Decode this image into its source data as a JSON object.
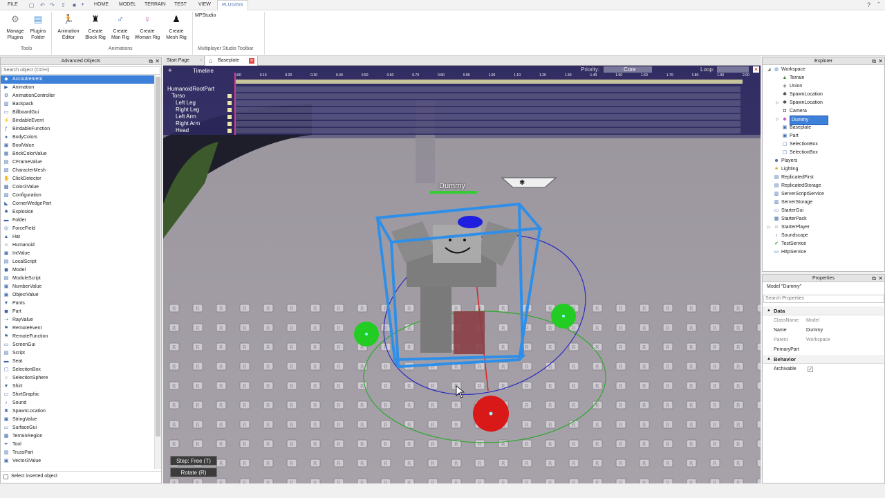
{
  "menubar": {
    "tabs": [
      "FILE",
      "HOME",
      "MODEL",
      "TERRAIN",
      "TEST",
      "VIEW",
      "PLUGINS"
    ]
  },
  "ribbon": {
    "buttons": {
      "manage_plugins": "Manage Plugins",
      "plugins_folder": "Plugins Folder",
      "animation_editor": "Animation Editor",
      "create_block_rig": "Create Block Rig",
      "create_man_rig": "Create Man Rig",
      "create_woman_rig": "Create Woman Rig",
      "create_mesh_rig": "Create Mesh Rig",
      "mpstudio": "MPStudio"
    },
    "groups": {
      "tools": "Tools",
      "animations": "Animations",
      "mp_toolbar": "Multiplayer Studio Toolbar"
    }
  },
  "advanced_objects": {
    "title": "Advanced Objects",
    "search_placeholder": "Search object (Ctrl+I)",
    "items": [
      "Accoutrement",
      "Animation",
      "AnimationController",
      "Backpack",
      "BillboardGui",
      "BindableEvent",
      "BindableFunction",
      "BodyColors",
      "BoolValue",
      "BrickColorValue",
      "CFrameValue",
      "CharacterMesh",
      "ClickDetector",
      "Color3Value",
      "Configuration",
      "CornerWedgePart",
      "Explosion",
      "Folder",
      "ForceField",
      "Hat",
      "Humanoid",
      "IntValue",
      "LocalScript",
      "Model",
      "ModuleScript",
      "NumberValue",
      "ObjectValue",
      "Pants",
      "Part",
      "RayValue",
      "RemoteEvent",
      "RemoteFunction",
      "ScreenGui",
      "Script",
      "Seat",
      "SelectionBox",
      "SelectionSphere",
      "Shirt",
      "ShirtGraphic",
      "Sound",
      "SpawnLocation",
      "StringValue",
      "SurfaceGui",
      "TerrainRegion",
      "Tool",
      "TrussPart",
      "Vector3Value"
    ],
    "selected_index": 0,
    "footer_checkbox": "Select inserted object"
  },
  "tabs": {
    "start_page": "Start Page",
    "baseplate": "Baseplate"
  },
  "timeline": {
    "title": "Timeline",
    "plus": "+",
    "priority_label": "Priority:",
    "priority_value": "Core",
    "loop_label": "Loop:",
    "ticks": [
      "0.00",
      "0.10",
      "0.20",
      "0.30",
      "0.40",
      "0.50",
      "0.60",
      "0.70",
      "0.80",
      "0.90",
      "1.00",
      "1.10",
      "1.20",
      "1.30",
      "1.40",
      "1.50",
      "1.60",
      "1.70",
      "1.80",
      "1.90",
      "2.00"
    ],
    "parts": [
      "HumanoidRootPart",
      "Torso",
      "Left Leg",
      "Right Leg",
      "Left Arm",
      "Right Arm",
      "Head"
    ],
    "close": "×"
  },
  "viewport": {
    "dummy_label": "Dummy",
    "step_button": "Step: Free (T)",
    "rotate_button": "Rotate (R)"
  },
  "explorer": {
    "title": "Explorer",
    "items": [
      {
        "label": "Workspace",
        "level": 0,
        "icon": "globe"
      },
      {
        "label": "Terrain",
        "level": 1,
        "icon": "terrain"
      },
      {
        "label": "Union",
        "level": 1,
        "icon": "union"
      },
      {
        "label": "SpawnLocation",
        "level": 1,
        "icon": "spawn"
      },
      {
        "label": "SpawnLocation",
        "level": 1,
        "icon": "spawn"
      },
      {
        "label": "Camera",
        "level": 1,
        "icon": "camera"
      },
      {
        "label": "Dummy",
        "level": 1,
        "icon": "model"
      },
      {
        "label": "Baseplate",
        "level": 1,
        "icon": "part"
      },
      {
        "label": "Part",
        "level": 1,
        "icon": "part"
      },
      {
        "label": "SelectionBox",
        "level": 1,
        "icon": "selection"
      },
      {
        "label": "SelectionBox",
        "level": 1,
        "icon": "selection"
      },
      {
        "label": "Players",
        "level": 0,
        "icon": "players"
      },
      {
        "label": "Lighting",
        "level": 0,
        "icon": "lighting"
      },
      {
        "label": "ReplicatedFirst",
        "level": 0,
        "icon": "replicated"
      },
      {
        "label": "ReplicatedStorage",
        "level": 0,
        "icon": "replicated"
      },
      {
        "label": "ServerScriptService",
        "level": 0,
        "icon": "server"
      },
      {
        "label": "ServerStorage",
        "level": 0,
        "icon": "server"
      },
      {
        "label": "StarterGui",
        "level": 0,
        "icon": "gui"
      },
      {
        "label": "StarterPack",
        "level": 0,
        "icon": "pack"
      },
      {
        "label": "StarterPlayer",
        "level": 0,
        "icon": "player"
      },
      {
        "label": "Soundscape",
        "level": 0,
        "icon": "sound"
      },
      {
        "label": "TestService",
        "level": 0,
        "icon": "test"
      },
      {
        "label": "HttpService",
        "level": 0,
        "icon": "http"
      }
    ],
    "selected_index": 6
  },
  "properties": {
    "title": "Properties",
    "header": "Model \"Dummy\"",
    "search_placeholder": "Search Properties",
    "categories": {
      "data": "Data",
      "behavior": "Behavior"
    },
    "rows": {
      "classname_key": "ClassName",
      "classname_val": "Model",
      "name_key": "Name",
      "name_val": "Dummy",
      "parent_key": "Parent",
      "parent_val": "Workspace",
      "primary_key": "PrimaryPart",
      "primary_val": "",
      "archivable_key": "Archivable"
    }
  }
}
